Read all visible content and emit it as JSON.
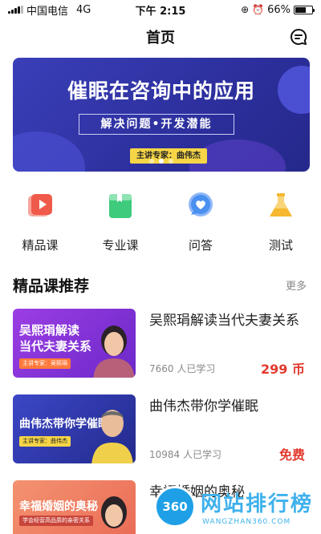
{
  "status_bar": {
    "carrier": "中国电信",
    "network": "4G",
    "time": "下午 2:15",
    "battery": "66%",
    "battery_level": 0.66
  },
  "nav": {
    "title": "首页",
    "message_icon": "message-icon"
  },
  "banner": {
    "title": "催眠在咨询中的应用",
    "subtitle": "解决问题•开发潜能",
    "speaker": "主讲专家：曲伟杰"
  },
  "categories": [
    {
      "label": "精品课",
      "icon": "video-play-icon",
      "color": "#f05a4a"
    },
    {
      "label": "专业课",
      "icon": "book-icon",
      "color": "#3ecb7c"
    },
    {
      "label": "问答",
      "icon": "heart-chat-icon",
      "color": "#4a90f0"
    },
    {
      "label": "测试",
      "icon": "flask-icon",
      "color": "#f5b82e"
    }
  ],
  "section": {
    "title": "精品课推荐",
    "more": "更多"
  },
  "courses": [
    {
      "title": "吴熙琄解读当代夫妻关系",
      "thumb_title": [
        "吴熙琄解读",
        "当代夫妻关系"
      ],
      "thumb_tag": "主讲专家：吴熙琄",
      "learners": "7660 人已学习",
      "price": "299 币",
      "bg": "#8a2fd8"
    },
    {
      "title": "曲伟杰带你学催眠",
      "thumb_title": [
        "曲伟杰带你学催眠"
      ],
      "thumb_tag": "主讲专家：曲伟杰",
      "learners": "10984 人已学习",
      "price": "免费",
      "bg": "#2f3aa8"
    },
    {
      "title": "幸福婚姻的奥秘",
      "thumb_title": [
        "幸福婚姻的奥秘"
      ],
      "thumb_tag": "学会经营高品质的亲密关系",
      "bg": "#f07a5c"
    }
  ],
  "watermark": {
    "badge": "360",
    "text": "网站排行榜",
    "sub": "WANGZHAN360.COM"
  }
}
